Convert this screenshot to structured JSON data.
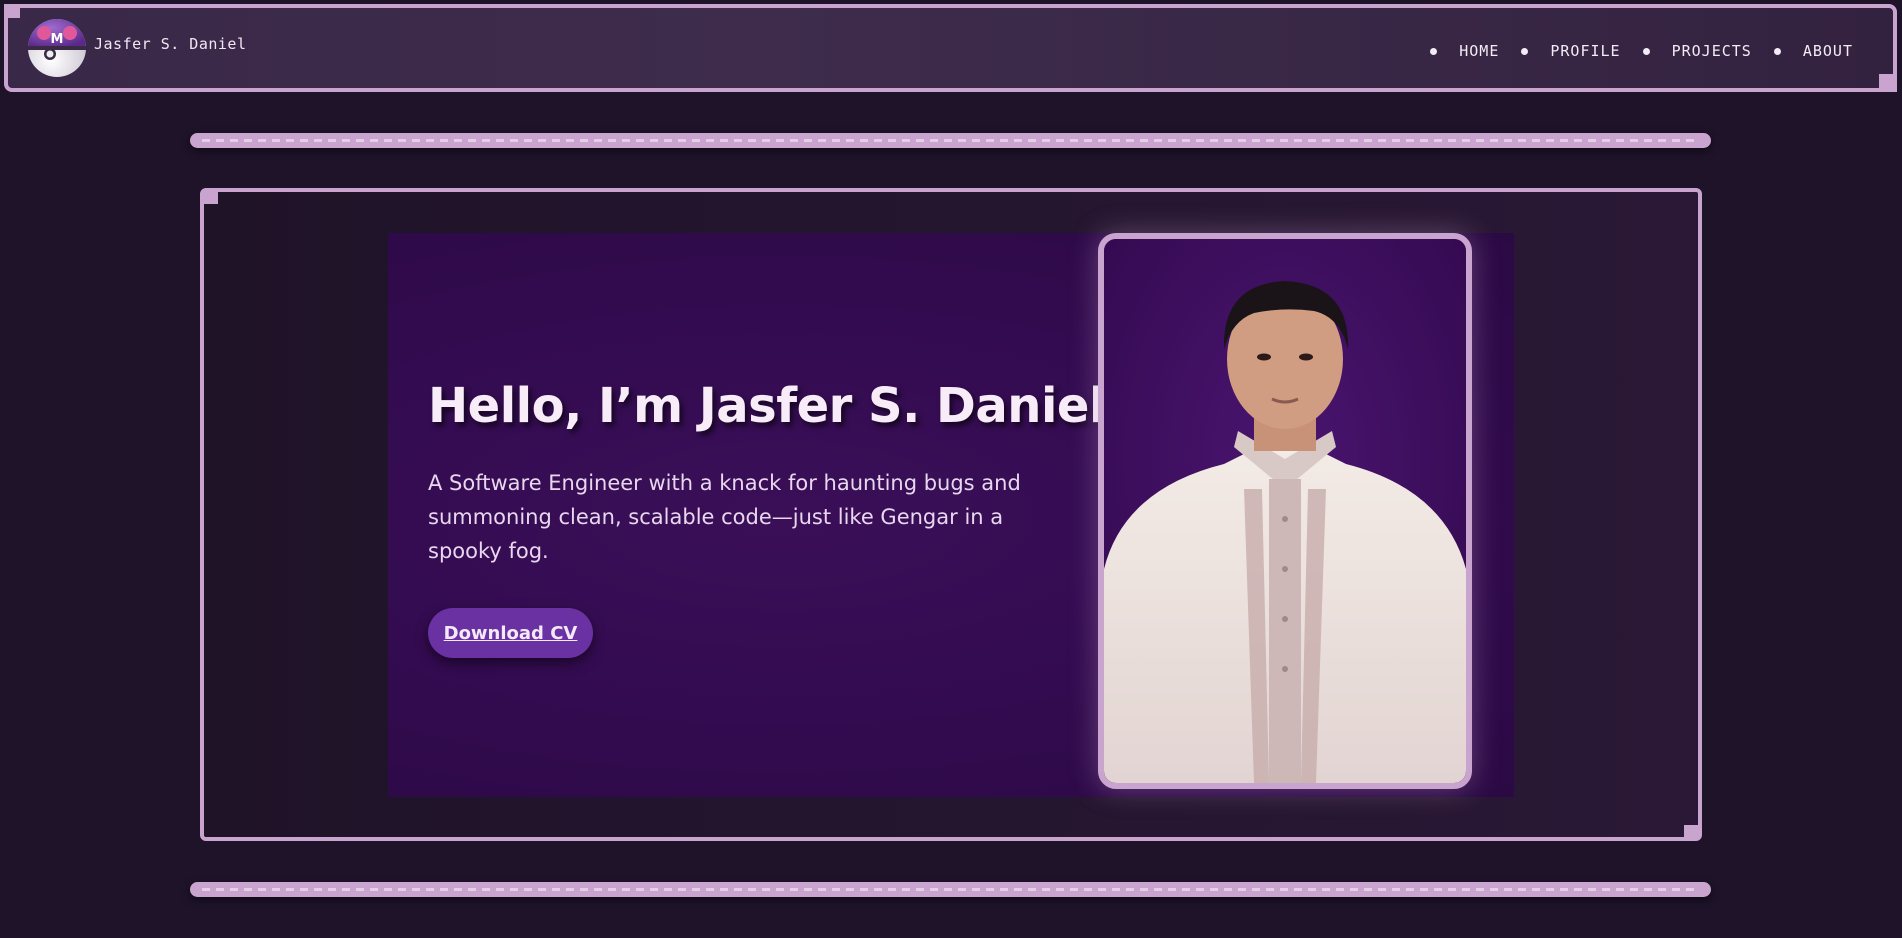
{
  "header": {
    "brand_name": "Jasfer S. Daniel",
    "logo_icon": "master-ball-icon",
    "nav": [
      {
        "label": "HOME"
      },
      {
        "label": "PROFILE"
      },
      {
        "label": "PROJECTS"
      },
      {
        "label": "ABOUT"
      }
    ]
  },
  "hero": {
    "title": "Hello, I’m Jasfer S. Daniel",
    "subtitle": "A Software Engineer with a knack for haunting bugs and summoning clean, scalable code—just like Gengar in a spooky fog.",
    "cv_button": "Download CV",
    "photo_icon": "profile-portrait-image"
  },
  "colors": {
    "accent": "#c9a4cf",
    "background": "#1e1329",
    "hero_bg": "#330b50",
    "button": "#6a31a3"
  }
}
